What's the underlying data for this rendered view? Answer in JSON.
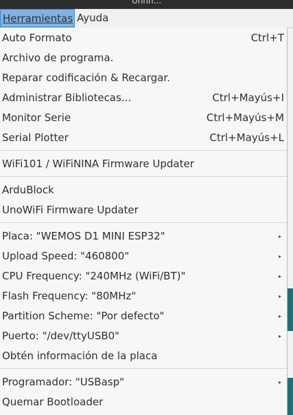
{
  "titlebar": {
    "title": "Unnn..."
  },
  "menubar": {
    "herramientas": "Herramientas",
    "ayuda": "Ayuda"
  },
  "menu": {
    "auto_formato": {
      "label": "Auto Formato",
      "accel": "Ctrl+T"
    },
    "archivo_programa": {
      "label": "Archivo de programa."
    },
    "reparar": {
      "label": "Reparar codificación & Recargar."
    },
    "administrar": {
      "label": "Administrar Bibliotecas...",
      "accel": "Ctrl+Mayús+I"
    },
    "monitor": {
      "label": "Monitor Serie",
      "accel": "Ctrl+Mayús+M"
    },
    "plotter": {
      "label": "Serial Plotter",
      "accel": "Ctrl+Mayús+L"
    },
    "wifi101": {
      "label": "WiFi101 / WiFiNINA Firmware Updater"
    },
    "ardublock": {
      "label": "ArduBlock"
    },
    "unowifi": {
      "label": "UnoWiFi Firmware Updater"
    },
    "placa": {
      "label": "Placa: \"WEMOS D1 MINI ESP32\""
    },
    "upload_speed": {
      "label": "Upload Speed: \"460800\""
    },
    "cpu_freq": {
      "label": "CPU Frequency: \"240MHz (WiFi/BT)\""
    },
    "flash_freq": {
      "label": "Flash Frequency: \"80MHz\""
    },
    "partition": {
      "label": "Partition Scheme: \"Por defecto\""
    },
    "puerto": {
      "label": "Puerto: \"/dev/ttyUSB0\""
    },
    "info_placa": {
      "label": "Obtén información de la placa"
    },
    "programador": {
      "label": "Programador: \"USBasp\""
    },
    "bootloader": {
      "label": "Quemar Bootloader"
    },
    "submenu_arrow": "▸"
  }
}
